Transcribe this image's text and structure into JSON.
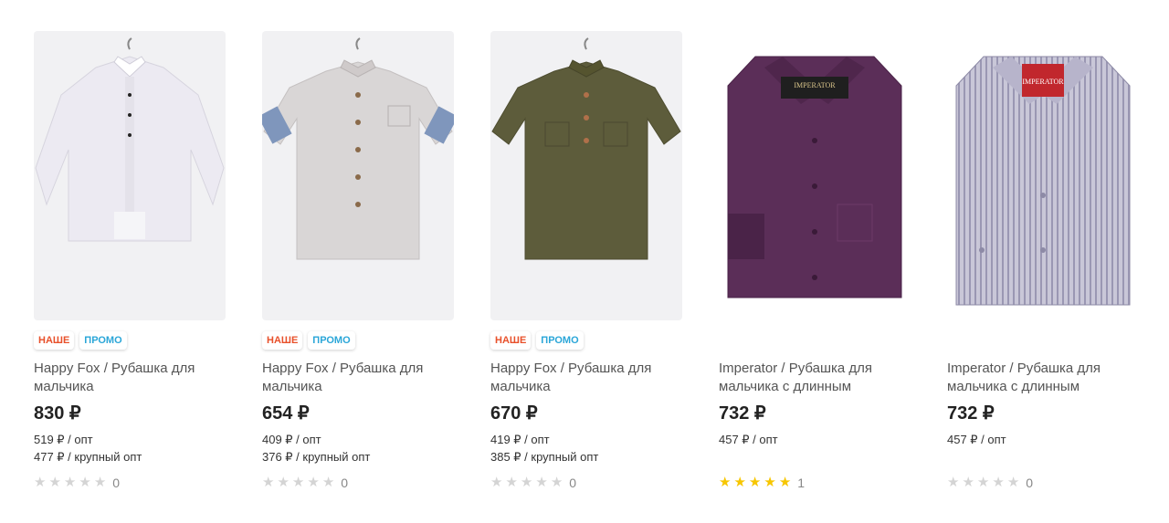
{
  "colors": {
    "badge_nashe": "#e8502a",
    "badge_promo": "#2aa6d8",
    "star_on": "#f7c600",
    "star_off": "#d4d4d4"
  },
  "products": [
    {
      "badges": [
        "НАШЕ",
        "ПРОМО"
      ],
      "title": "Happy Fox / Рубашка для мальчика",
      "price": "830 ₽",
      "opt": "519 ₽ / опт",
      "big_opt": "477 ₽ / крупный опт",
      "stars": 0,
      "reviews": "0",
      "image_icon": "white-shirt-image"
    },
    {
      "badges": [
        "НАШЕ",
        "ПРОМО"
      ],
      "title": "Happy Fox / Рубашка для мальчика",
      "price": "654 ₽",
      "opt": "409 ₽ / опт",
      "big_opt": "376 ₽ / крупный опт",
      "stars": 0,
      "reviews": "0",
      "image_icon": "beige-short-sleeve-shirt-image"
    },
    {
      "badges": [
        "НАШЕ",
        "ПРОМО"
      ],
      "title": "Happy Fox / Рубашка для мальчика",
      "price": "670 ₽",
      "opt": "419 ₽ / опт",
      "big_opt": "385 ₽ / крупный опт",
      "stars": 0,
      "reviews": "0",
      "image_icon": "khaki-short-sleeve-shirt-image"
    },
    {
      "badges": [],
      "title": "Imperator / Рубашка для мальчика с длинным",
      "price": "732 ₽",
      "opt": "457 ₽ / опт",
      "big_opt": "",
      "stars": 5,
      "reviews": "1",
      "image_icon": "purple-shirt-image",
      "logo_text": "IMPERATOR"
    },
    {
      "badges": [],
      "title": "Imperator / Рубашка для мальчика с длинным",
      "price": "732 ₽",
      "opt": "457 ₽ / опт",
      "big_opt": "",
      "stars": 0,
      "reviews": "0",
      "image_icon": "striped-shirt-image",
      "logo_text": "IMPERATOR"
    }
  ]
}
